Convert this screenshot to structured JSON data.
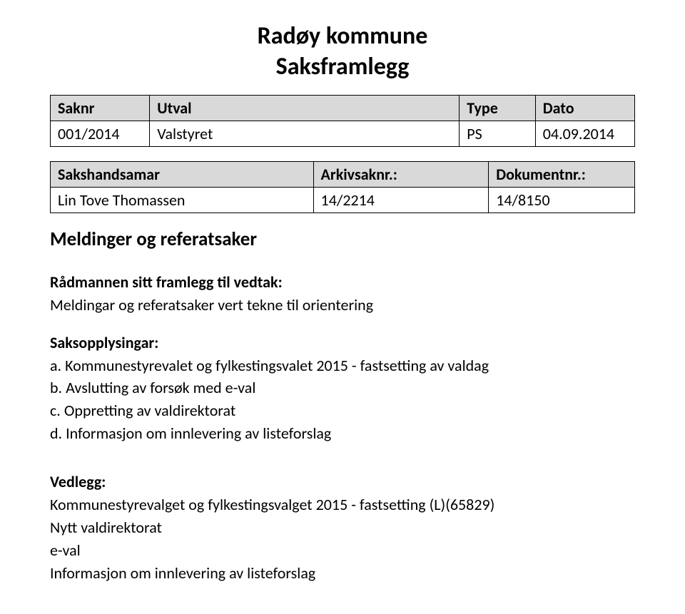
{
  "header": {
    "municipality": "Radøy kommune",
    "doc_type": "Saksframlegg"
  },
  "case_table": {
    "headers": {
      "saknr": "Saknr",
      "utval": "Utval",
      "type": "Type",
      "dato": "Dato"
    },
    "row": {
      "saknr": "001/2014",
      "utval": "Valstyret",
      "type": "PS",
      "dato": "04.09.2014"
    }
  },
  "handler_table": {
    "headers": {
      "name": "Sakshandsamar",
      "arkiv": "Arkivsaknr.:",
      "dok": "Dokumentnr.:"
    },
    "row": {
      "name": "Lin Tove Thomassen",
      "arkiv": "14/2214",
      "dok": "14/8150"
    }
  },
  "title": "Meldinger og referatsaker",
  "framlegg": {
    "heading": "Rådmannen sitt framlegg til vedtak:",
    "text": "Meldingar og referatsaker vert tekne til orientering"
  },
  "saksopplysingar": {
    "heading": "Saksopplysingar:",
    "items": {
      "a": "a. Kommunestyrevalet og fylkestingsvalet 2015 - fastsetting av valdag",
      "b": "b. Avslutting av forsøk med e-val",
      "c": "c. Oppretting av valdirektorat",
      "d": "d. Informasjon om innlevering av listeforslag"
    }
  },
  "vedlegg": {
    "heading": "Vedlegg:",
    "items": {
      "0": "Kommunestyrevalget og fylkestingsvalget 2015 - fastsetting  (L)(65829)",
      "1": "Nytt valdirektorat",
      "2": "e-val",
      "3": "Informasjon om innlevering av listeforslag"
    }
  }
}
